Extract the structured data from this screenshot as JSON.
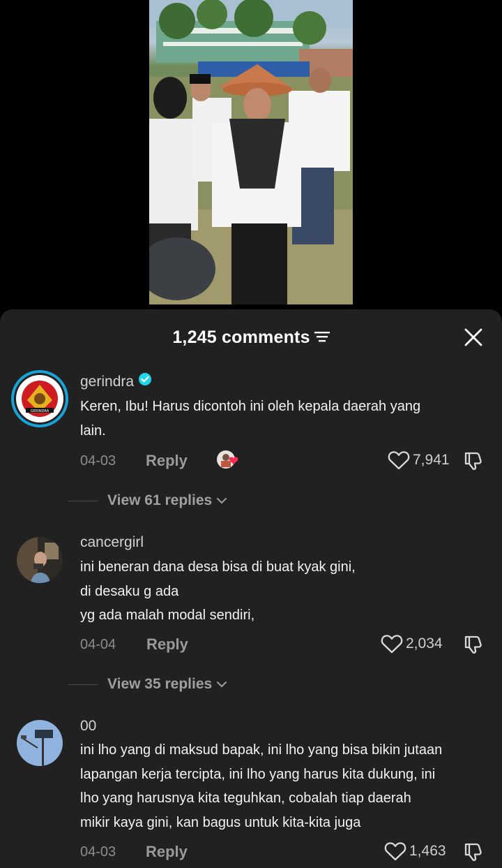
{
  "header": {
    "comment_count": "1,245 comments"
  },
  "comments": [
    {
      "username": "gerindra",
      "verified": true,
      "text_lines": [
        "Keren, Ibu! Harus dicontoh ini oleh kepala daerah yang",
        "lain."
      ],
      "date": "04-03",
      "reply_label": "Reply",
      "likes": "7,941",
      "replies_label": "View 61 replies",
      "avatar_label": "GERINDRA"
    },
    {
      "username": "cancergirl",
      "verified": false,
      "text_lines": [
        "ini beneran dana desa bisa di buat kyak gini,",
        "di desaku g ada",
        "yg ada malah modal sendiri,"
      ],
      "date": "04-04",
      "reply_label": "Reply",
      "likes": "2,034",
      "replies_label": "View 35 replies"
    },
    {
      "username": "00",
      "verified": false,
      "text_lines": [
        "ini lho yang di maksud bapak, ini lho yang bisa bikin jutaan",
        "lapangan kerja tercipta, ini lho yang harus kita dukung, ini",
        "lho yang harusnya kita teguhkan, cobalah tiap daerah",
        "mikir kaya gini, kan bagus untuk kita-kita juga"
      ],
      "date": "04-03",
      "reply_label": "Reply",
      "likes": "1,463"
    }
  ],
  "colors": {
    "sheet_bg": "#212121",
    "verified": "#20d5ec",
    "liked_heart": "#fe2c55"
  },
  "icons": [
    "filter-icon",
    "close-icon",
    "verified-icon",
    "heart-icon",
    "dislike-icon",
    "chevron-down-icon"
  ]
}
